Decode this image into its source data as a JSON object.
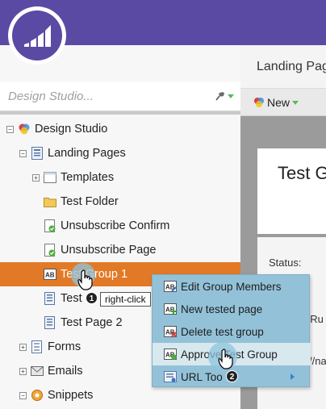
{
  "header": {
    "logo_icon": "marketo-logo-icon",
    "color": "#5b4aa3"
  },
  "search": {
    "placeholder": "Design Studio..."
  },
  "tree": {
    "items": [
      {
        "label": "Design Studio",
        "expander": "−",
        "icon": "design-studio-icon"
      },
      {
        "label": "Landing Pages",
        "expander": "−",
        "icon": "landing-pages-icon"
      },
      {
        "label": "Templates",
        "expander": "+",
        "icon": "templates-icon"
      },
      {
        "label": "Test Folder",
        "expander": "",
        "icon": "folder-icon"
      },
      {
        "label": "Unsubscribe Confirm",
        "expander": "",
        "icon": "approved-page-icon"
      },
      {
        "label": "Unsubscribe Page",
        "expander": "",
        "icon": "approved-page-icon"
      },
      {
        "label": "Test Group 1",
        "expander": "",
        "icon": "test-group-icon",
        "selected": true
      },
      {
        "label": "Test",
        "expander": "",
        "icon": "page-icon"
      },
      {
        "label": "Test Page 2",
        "expander": "",
        "icon": "page-icon"
      },
      {
        "label": "Forms",
        "expander": "+",
        "icon": "forms-icon"
      },
      {
        "label": "Emails",
        "expander": "+",
        "icon": "emails-icon"
      },
      {
        "label": "Snippets",
        "expander": "−",
        "icon": "snippets-icon"
      }
    ]
  },
  "right_panel": {
    "title": "Landing Pag",
    "new_button": "New",
    "card_title": "Test G",
    "status_label": "Status:",
    "fragment_1": "t Ru",
    "fragment_2": "//na"
  },
  "context_menu": {
    "items": [
      {
        "label": "Edit Group Members",
        "icon": "edit-group-members-icon"
      },
      {
        "label": "New tested page",
        "icon": "new-tested-page-icon"
      },
      {
        "label": "Delete test group",
        "icon": "delete-test-group-icon"
      },
      {
        "label": "Approve Test Group",
        "icon": "approve-test-group-icon",
        "hover": true
      },
      {
        "label": "URL Too",
        "icon": "url-tools-icon",
        "submenu": true
      }
    ]
  },
  "callouts": {
    "step1_number": "1",
    "step1_tooltip": "right-click",
    "step2_number": "2"
  },
  "colors": {
    "accent_selected": "#e27926",
    "menu_bg": "#93c2d8",
    "menu_hover": "#d8e8ef"
  }
}
